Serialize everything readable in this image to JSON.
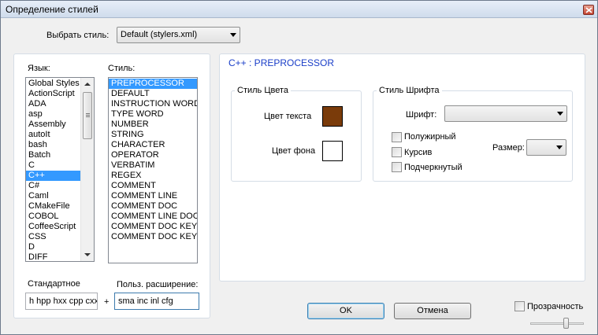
{
  "window": {
    "title": "Определение стилей"
  },
  "theme": {
    "label": "Выбрать стиль:",
    "selected": "Default (stylers.xml)"
  },
  "language": {
    "label": "Язык:",
    "items": [
      "Global Styles",
      "ActionScript",
      "ADA",
      "asp",
      "Assembly",
      "autoIt",
      "bash",
      "Batch",
      "C",
      "C++",
      "C#",
      "Caml",
      "CMakeFile",
      "COBOL",
      "CoffeeScript",
      "CSS",
      "D",
      "DIFF"
    ],
    "selected_index": 9
  },
  "style": {
    "label": "Стиль:",
    "items": [
      "PREPROCESSOR",
      "DEFAULT",
      "INSTRUCTION WORD",
      "TYPE WORD",
      "NUMBER",
      "STRING",
      "CHARACTER",
      "OPERATOR",
      "VERBATIM",
      "REGEX",
      "COMMENT",
      "COMMENT LINE",
      "COMMENT DOC",
      "COMMENT LINE DOC",
      "COMMENT DOC KEYWORD",
      "COMMENT DOC KEYWORD ERROR"
    ],
    "selected_index": 0
  },
  "extensions": {
    "default_label": "Стандартное",
    "default_value": "h hpp hxx cpp cxx cc",
    "plus": "+",
    "user_label": "Польз. расширение:",
    "user_value": "sma inc inl cfg"
  },
  "header": {
    "style_name": "C++ : PREPROCESSOR",
    "color": "#1a3ec8"
  },
  "colour_style": {
    "title": "Стиль Цвета",
    "fg_label": "Цвет текста",
    "fg_color": "#7a3b0a",
    "bg_label": "Цвет фона",
    "bg_color": "#ffffff"
  },
  "font_style": {
    "title": "Стиль Шрифта",
    "font_label": "Шрифт:",
    "font_value": "",
    "bold_label": "Полужирный",
    "italic_label": "Курсив",
    "underline_label": "Подчеркнутый",
    "size_label": "Размер:",
    "size_value": ""
  },
  "buttons": {
    "ok": "OK",
    "cancel": "Отмена"
  },
  "transparency": {
    "label": "Прозрачность",
    "checked": false,
    "slider_value": 0.66
  }
}
